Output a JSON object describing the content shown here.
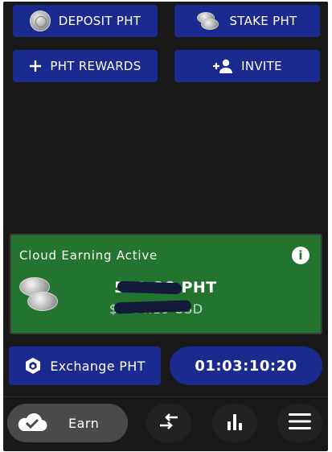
{
  "actions": {
    "deposit_label": "DEPOSIT PHT",
    "stake_label": "STAKE PHT",
    "rewards_label": "PHT REWARDS",
    "invite_label": "INVITE"
  },
  "earning_card": {
    "title": "Cloud Earning Active",
    "balance_value": "540.38",
    "balance_unit": "PHT",
    "usd_value": "$0.14.19",
    "usd_unit": "USD"
  },
  "exchange": {
    "label": "Exchange PHT"
  },
  "timer": {
    "value": "01:03:10:20"
  },
  "nav": {
    "earn_label": "Earn"
  },
  "icons": {
    "deposit": "coin-icon",
    "stake": "stacked-coins-icon",
    "rewards": "plus-icon",
    "invite": "add-person-icon",
    "info": "info-icon",
    "exchange": "cube-icon",
    "earn": "cloud-check-icon",
    "swap": "swap-arrows-icon",
    "stats": "bar-chart-icon",
    "menu": "hamburger-menu-icon"
  },
  "colors": {
    "background": "#191919",
    "button_blue": "#1b2a8f",
    "card_green": "#22742e"
  }
}
